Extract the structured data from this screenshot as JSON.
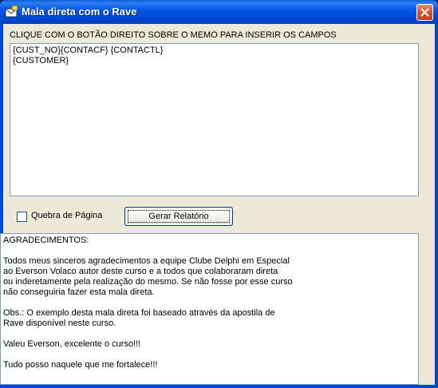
{
  "window": {
    "title": "Mala direta com o Rave"
  },
  "instruction": "CLIQUE COM O BOTÃO DIREITO SOBRE O MEMO PARA INSERIR OS CAMPOS",
  "template_memo": {
    "text": "{CUST_NO}{CONTACF} {CONTACTL}\n{CUSTOMER}"
  },
  "page_break_checkbox": {
    "label": "Quebra de Página",
    "checked": false
  },
  "generate_button": {
    "label": "Gerar Relatório"
  },
  "thanks_memo": {
    "text": "AGRADECIMENTOS:\n\nTodos meus sinceros agradecimentos a equipe Clube Delphi em Especial\nao Everson Volaco autor deste curso e a todos que colaboraram direta\nou inderetamente pela realização do mesmo. Se não fosse por esse curso\nnão conseguiria fazer esta mala direta.\n\nObs.: O exemplo desta mala direta foi baseado através da apostila de\nRave disponível neste curso.\n\nValeu Everson, excelente o curso!!!\n\nTudo posso naquele que me fortalece!!!"
  },
  "icons": {
    "app": "mail-envelope-icon",
    "close": "close-icon"
  },
  "colors": {
    "titlebar": "#0055E5",
    "client": "#ECE9D8",
    "close": "#D4532F"
  }
}
